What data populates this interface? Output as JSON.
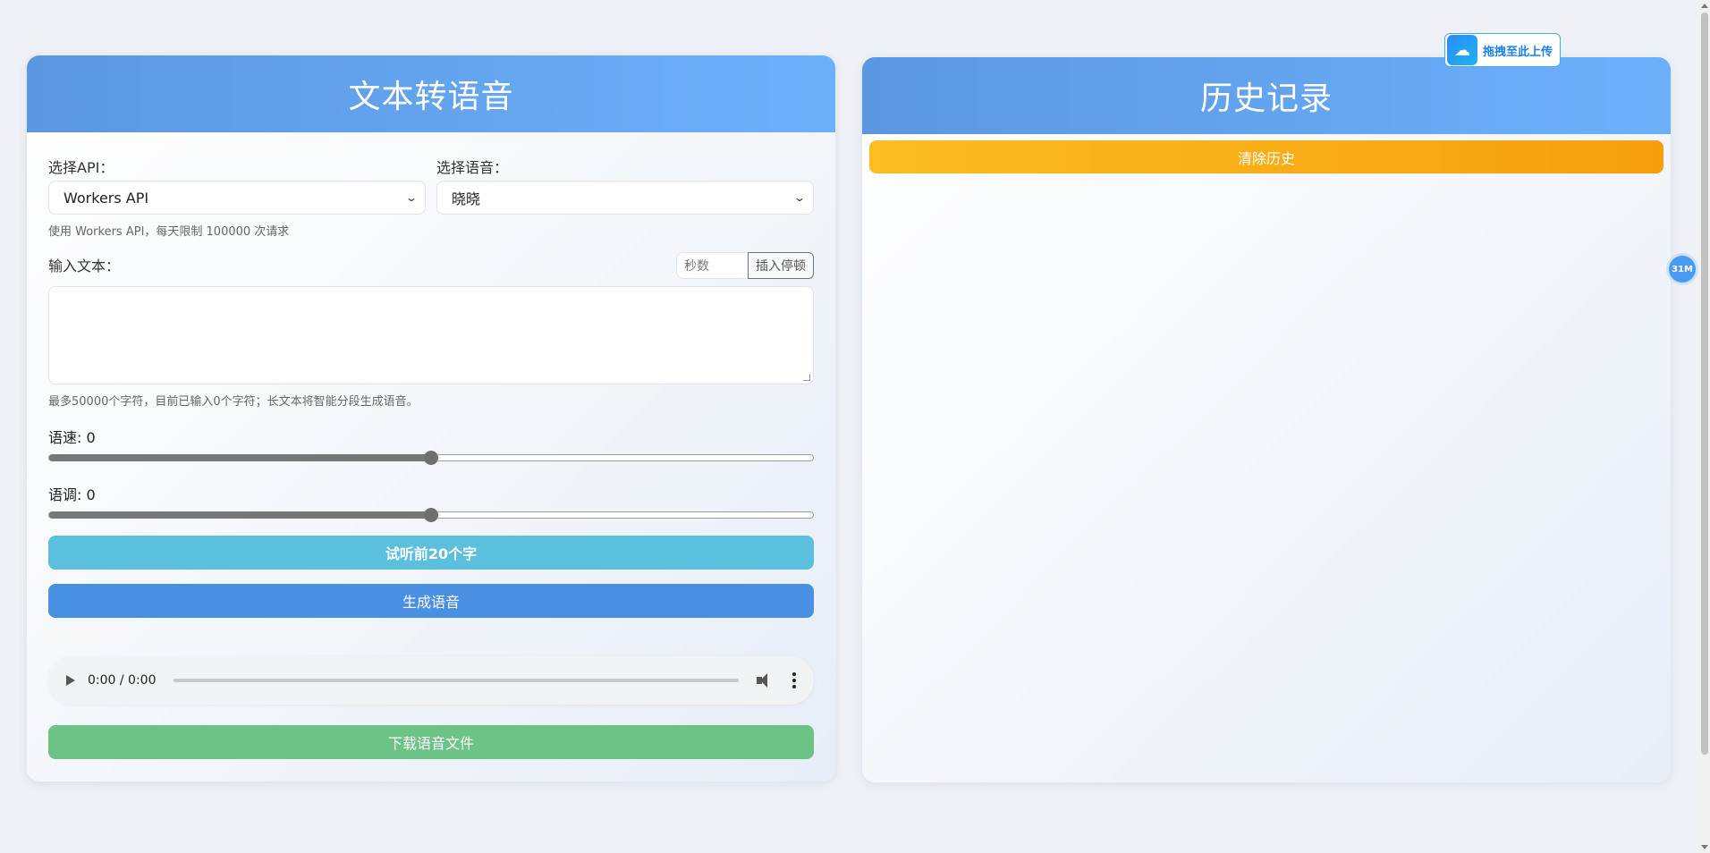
{
  "tts": {
    "title": "文本转语音",
    "api_label": "选择API：",
    "api_value": "Workers API",
    "voice_label": "选择语音：",
    "voice_value": "晓晓",
    "api_hint": "使用 Workers API，每天限制 100000 次请求",
    "text_label": "输入文本：",
    "pause_placeholder": "秒数",
    "pause_button": "插入停顿",
    "text_value": "",
    "char_hint": "最多50000个字符，目前已输入0个字符；长文本将智能分段生成语音。",
    "speed_label": "语速: 0",
    "speed_level": 0.5,
    "pitch_label": "语调: 0",
    "pitch_level": 0.5,
    "preview_button": "试听前20个字",
    "generate_button": "生成语音",
    "audio_time": "0:00 / 0:00",
    "download_button": "下载语音文件"
  },
  "history": {
    "title": "历史记录",
    "clear_button": "清除历史",
    "items": []
  },
  "widgets": {
    "upload_label": "拖拽至此上传",
    "side_badge": "31M"
  },
  "colors": {
    "header_gradient_start": "#5b97e2",
    "header_gradient_end": "#6cb0fb",
    "preview_btn": "#5bc0de",
    "generate_btn": "#4a90e2",
    "download_btn": "#6cc386",
    "clear_btn": "#f7ad18"
  }
}
